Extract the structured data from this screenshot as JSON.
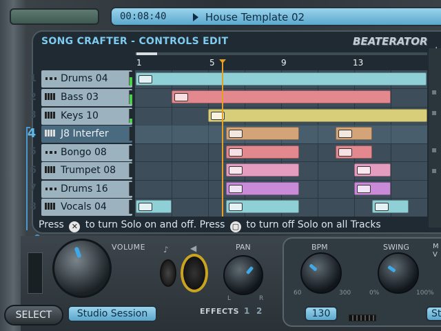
{
  "header": {
    "time": "00:08:40",
    "song_name": "House Template 02"
  },
  "panel": {
    "title": "SONG CRAFTER - CONTROLS EDIT",
    "brand": "BEATERATOR"
  },
  "timeline": {
    "markers": [
      "1",
      "5",
      "9",
      "13"
    ]
  },
  "tracks": [
    {
      "number": "1",
      "name": "Drums 04",
      "selected": false
    },
    {
      "number": "2",
      "name": "Bass 03",
      "selected": false
    },
    {
      "number": "3",
      "name": "Keys 10",
      "selected": false
    },
    {
      "number": "4",
      "name": "J8   Interfer",
      "selected": true
    },
    {
      "number": "5",
      "name": "Bongo 08",
      "selected": false
    },
    {
      "number": "6",
      "name": "Trumpet 08",
      "selected": false
    },
    {
      "number": "7",
      "name": "Drums 16",
      "selected": false
    },
    {
      "number": "8",
      "name": "Vocals 04",
      "selected": false
    }
  ],
  "help": {
    "part1": "Press",
    "part2": "to turn Solo on and off. Press",
    "part3": "to turn off Solo on all Tracks",
    "x_glyph": "✕",
    "sq_glyph": "▢"
  },
  "console": {
    "volume_label": "VOLUME",
    "pan_label": "PAN",
    "pan_left": "L",
    "pan_right": "R",
    "effects_label": "EFFECTS",
    "effect1": "1",
    "effect2": "2",
    "bpm_label": "BPM",
    "bpm_min": "60",
    "bpm_max": "300",
    "bpm_value": "130",
    "swing_label": "SWING",
    "swing_min": "0%",
    "swing_max": "100%",
    "mv_label_1": "M",
    "mv_label_2": "V",
    "right_lcd": "St",
    "select_label": "SELECT",
    "session_label": "Studio Session"
  },
  "colors": {
    "accent": "#5ba7cc",
    "playhead": "#e8a020",
    "title": "#7ecbef"
  }
}
